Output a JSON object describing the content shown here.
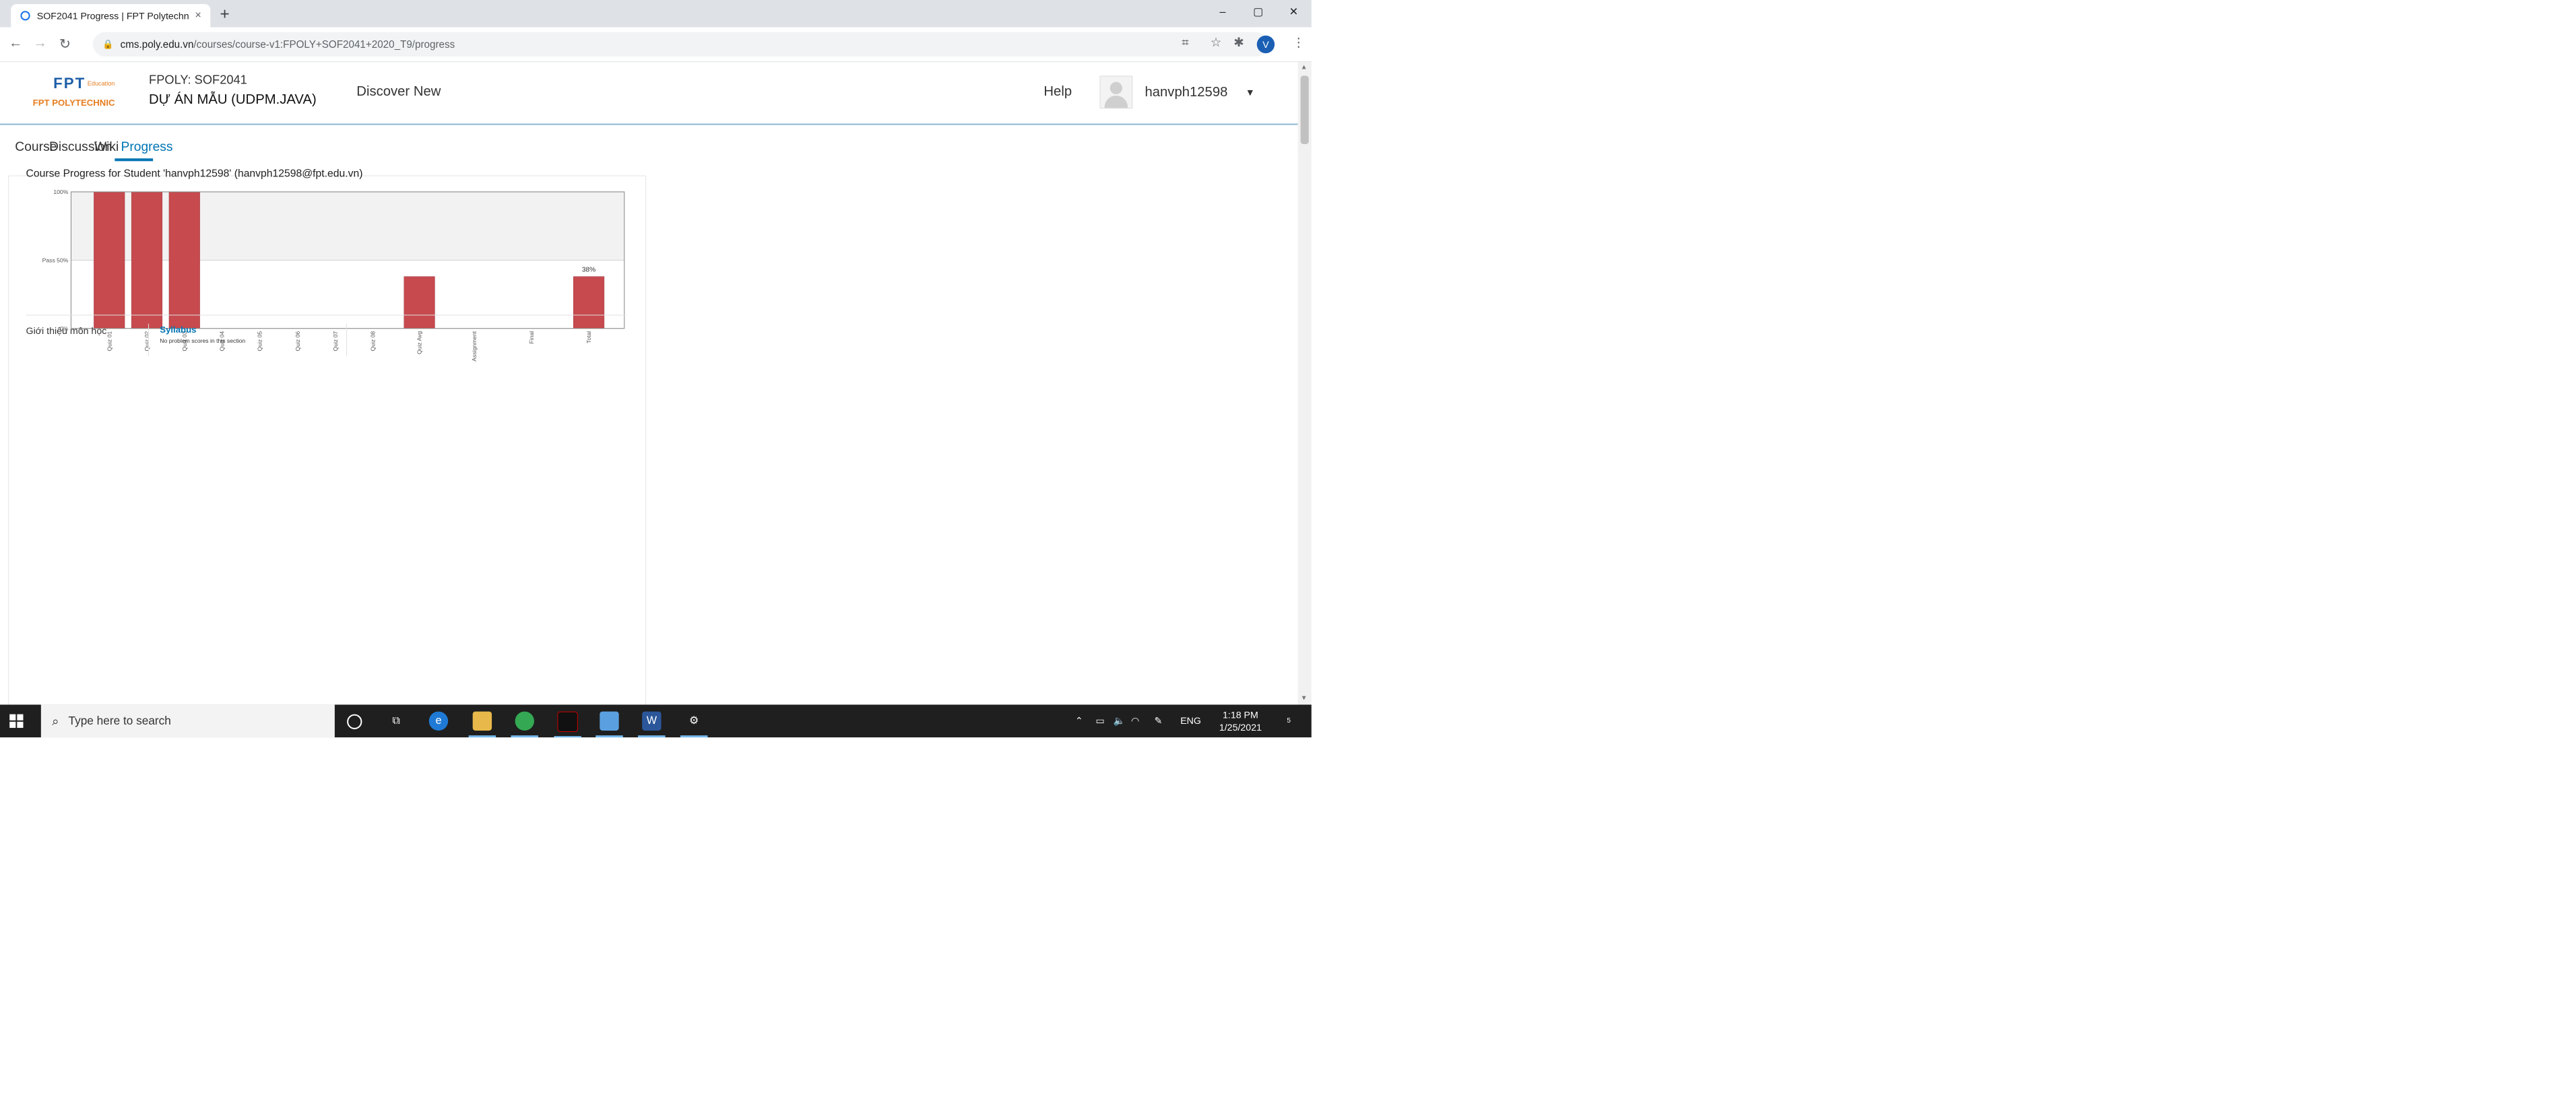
{
  "browser": {
    "tab_title": "SOF2041 Progress | FPT Polytechn",
    "tab_close": "×",
    "new_tab": "+",
    "url_host": "cms.poly.edu.vn",
    "url_path": "/courses/course-v1:FPOLY+SOF2041+2020_T9/progress",
    "profile_initial": "V",
    "window_controls": [
      "–",
      "▢",
      "✕"
    ]
  },
  "header": {
    "logo_text": "FPT POLYTECHNIC",
    "logo_mark": "FPT",
    "logo_edu": "Education",
    "course_code": "FPOLY: SOF2041",
    "course_name": "DỰ ÁN MẪU (UDPM.JAVA)",
    "discover": "Discover New",
    "help": "Help",
    "username": "hanvph12598",
    "caret": "▼"
  },
  "nav_tabs": [
    {
      "label": "Course",
      "active": false
    },
    {
      "label": "Discussion",
      "active": false
    },
    {
      "label": "Wiki",
      "active": false
    },
    {
      "label": "Progress",
      "active": true
    }
  ],
  "progress": {
    "title": "Course Progress for Student 'hanvph12598' (hanvph12598@fpt.edu.vn)"
  },
  "chart_data": {
    "type": "bar",
    "categories": [
      "Quiz 01",
      "Quiz 02",
      "Quiz 03",
      "Quiz 04",
      "Quiz 05",
      "Quiz 06",
      "Quiz 07",
      "Quiz 08",
      "Quiz Avg",
      "Assignment",
      "Final",
      "Total"
    ],
    "values": [
      100,
      100,
      100,
      0,
      0,
      0,
      0,
      0,
      38,
      0,
      0,
      38
    ],
    "ytick_labels": [
      "0%",
      "Pass 50%",
      "100%"
    ],
    "yticks": [
      0,
      50,
      100
    ],
    "ylim": [
      0,
      100
    ],
    "data_labels": {
      "Total": "38%"
    },
    "bar_color": "#c64a4e",
    "pass_band_color": "#f2f2f2",
    "pass_threshold": 50
  },
  "section": {
    "left_title": "Giới thiệu môn học",
    "subsection_title": "Syllabus",
    "subsection_note": "No problem scores in this section"
  },
  "taskbar": {
    "search_placeholder": "Type here to search",
    "lang": "ENG",
    "time": "1:18 PM",
    "date": "1/25/2021",
    "notif_count": "5"
  }
}
